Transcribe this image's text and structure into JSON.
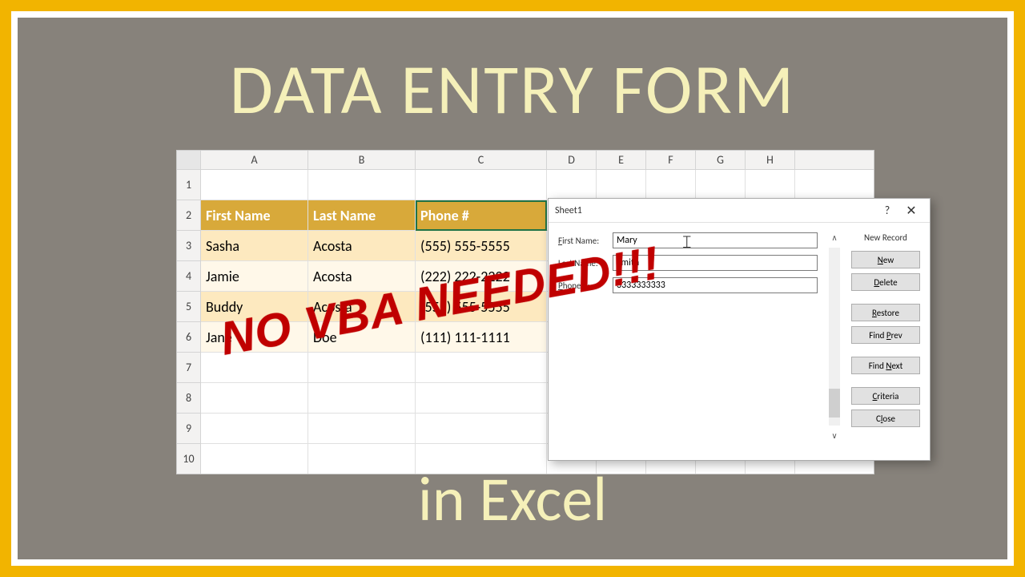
{
  "title": "DATA ENTRY FORM",
  "subtitle": "in Excel",
  "stamp": "NO VBA NEEDED!!!",
  "columns": [
    "A",
    "B",
    "C",
    "D",
    "E",
    "F",
    "G",
    "H"
  ],
  "col_widths": [
    "wA",
    "wB",
    "wC",
    "wD",
    "wE",
    "wF",
    "wG",
    "wH"
  ],
  "row_numbers": [
    "1",
    "2",
    "3",
    "4",
    "5",
    "6",
    "7",
    "8",
    "9",
    "10"
  ],
  "headers": [
    "First Name",
    "Last Name",
    "Phone #"
  ],
  "data_rows": [
    {
      "first": "Sasha",
      "last": "Acosta",
      "phone": "(555) 555-5555",
      "cls": "odd"
    },
    {
      "first": "Jamie",
      "last": "Acosta",
      "phone": "(222) 222-2222",
      "cls": "even"
    },
    {
      "first": "Buddy",
      "last": "Acosta",
      "phone": "(555) 555-5555",
      "cls": "odd"
    },
    {
      "first": "Jane",
      "last": "Doe",
      "phone": "(111) 111-1111",
      "cls": "even"
    }
  ],
  "active_cell": {
    "col": "C",
    "row": 2
  },
  "dialog": {
    "title": "Sheet1",
    "status": "New Record",
    "fields": [
      {
        "label": "First Name:",
        "value": "Mary"
      },
      {
        "label": "Last Name:",
        "value": "Smith"
      },
      {
        "label": "Phone #:",
        "value": "3333333333"
      }
    ],
    "buttons": [
      {
        "key": "new",
        "html": "<u>N</u>ew"
      },
      {
        "key": "delete",
        "html": "<u>D</u>elete"
      },
      {
        "key": "restore",
        "html": "<u>R</u>estore"
      },
      {
        "key": "find-prev",
        "html": "Find <u>P</u>rev"
      },
      {
        "key": "find-next",
        "html": "Find <u>N</u>ext"
      },
      {
        "key": "criteria",
        "html": "<u>C</u>riteria"
      },
      {
        "key": "close",
        "html": "C<u>l</u>ose"
      }
    ]
  }
}
